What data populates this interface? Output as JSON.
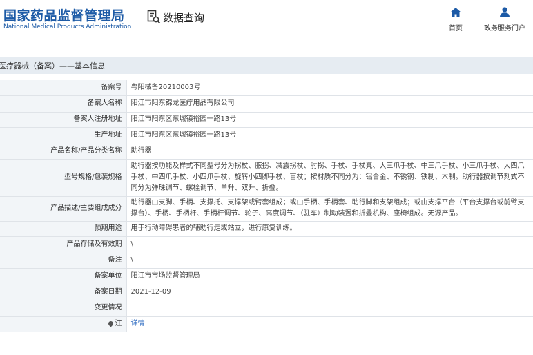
{
  "header": {
    "logo_cn": "国家药品监督管理局",
    "logo_en": "National Medical Products Administration",
    "query_label": "数据查询",
    "nav": {
      "home_label": "首页",
      "portal_label": "政务服务门户"
    }
  },
  "breadcrumb": "医疗器械（备案）——基本信息",
  "rows": [
    {
      "key": "备案号",
      "value": "粤阳械备20210003号"
    },
    {
      "key": "备案人名称",
      "value": "阳江市阳东锦龙医疗用品有限公司"
    },
    {
      "key": "备案人注册地址",
      "value": "阳江市阳东区东城镇裕园一路13号"
    },
    {
      "key": "生产地址",
      "value": "阳江市阳东区东城镇裕园一路13号"
    },
    {
      "key": "产品名称/产品分类名称",
      "value": "助行器"
    },
    {
      "key": "型号规格/包装规格",
      "value": "助行器按功能及样式不同型号分为拐杖、腋拐、减震拐杖、肘拐、手杖、手杖凳、大三爪手杖、中三爪手杖、小三爪手杖、大四爪手杖、中四爪手杖、小四爪手杖、旋转小四脚手杖、盲杖；按材质不同分为：铝合金、不锈钢、铁制、木制。助行器按调节刻式不同分为弹珠调节、螺栓调节、单升、双升、折叠。"
    },
    {
      "key": "产品描述/主要组成成分",
      "value": "助行器由支脚、手柄、支撑托、支撑架或臂套组成；或由手柄、手柄套、助行脚和支架组成；或由支撑平台（平台支撑台或前臂支撑台）、手柄、手柄杆、手柄杆调节、轮子、高度调节、（驻车）制动装置和折叠机构、座椅组成。无源产品。"
    },
    {
      "key": "预期用途",
      "value": "用于行动障碍患者的辅助行走或站立，进行康复训练。"
    },
    {
      "key": "产品存储及有效期",
      "value": "\\"
    },
    {
      "key": "备注",
      "value": "\\"
    },
    {
      "key": "备案单位",
      "value": "阳江市市场监督管理局"
    },
    {
      "key": "备案日期",
      "value": "2021-12-09"
    },
    {
      "key": "变更情况",
      "value": ""
    },
    {
      "key": "注",
      "value": "详情"
    }
  ],
  "colors": {
    "brand_blue": "#1c5aa6",
    "link_blue": "#2d6bc1",
    "crumb_bg": "#e6ecf2",
    "key_bg": "#f2f5f8"
  }
}
